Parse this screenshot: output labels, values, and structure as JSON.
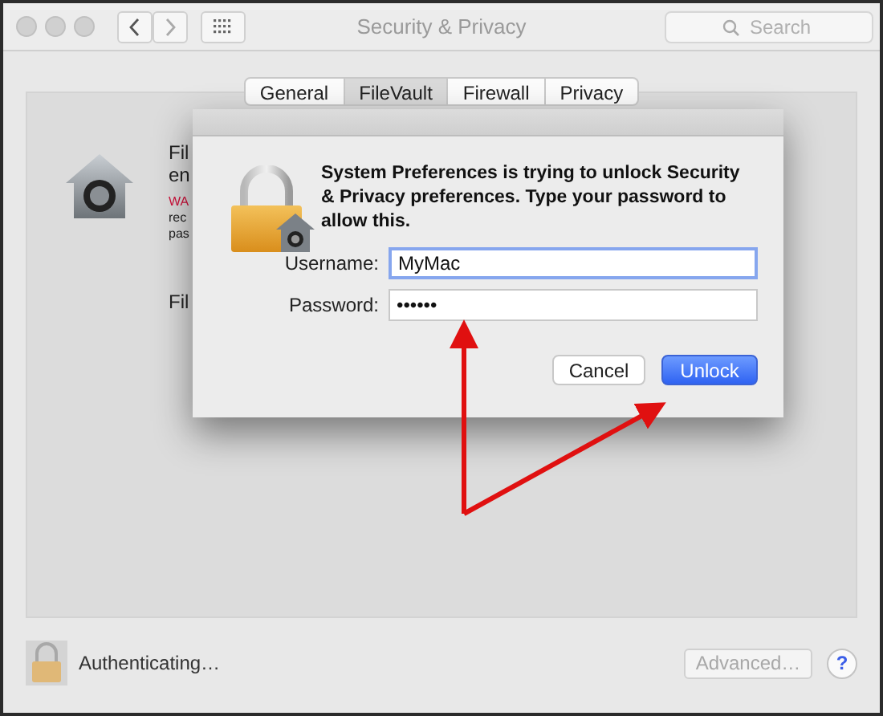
{
  "window": {
    "title": "Security & Privacy",
    "search_placeholder": "Search"
  },
  "tabs": [
    {
      "label": "General",
      "selected": false
    },
    {
      "label": "FileVault",
      "selected": true
    },
    {
      "label": "Firewall",
      "selected": false
    },
    {
      "label": "Privacy",
      "selected": false
    }
  ],
  "pane_texts": [
    {
      "text": "Fil",
      "kind": "body"
    },
    {
      "text": "en",
      "kind": "body"
    },
    {
      "text": "WA",
      "kind": "warning"
    },
    {
      "text": "rec",
      "kind": "small"
    },
    {
      "text": "pas",
      "kind": "small"
    },
    {
      "text": "Fil",
      "kind": "section"
    }
  ],
  "dialog": {
    "message": "System Preferences is trying to unlock Security & Privacy preferences. Type your password to allow this.",
    "fields": [
      {
        "label": "Username:",
        "value": "MyMac",
        "focused": true
      },
      {
        "label": "Password:",
        "value": "••••••",
        "focused": false
      }
    ],
    "buttons": [
      {
        "label": "Cancel",
        "default": false
      },
      {
        "label": "Unlock",
        "default": true
      }
    ]
  },
  "footer": {
    "status": "Authenticating…",
    "advanced": {
      "label": "Advanced…",
      "disabled": true
    },
    "help": "?"
  }
}
